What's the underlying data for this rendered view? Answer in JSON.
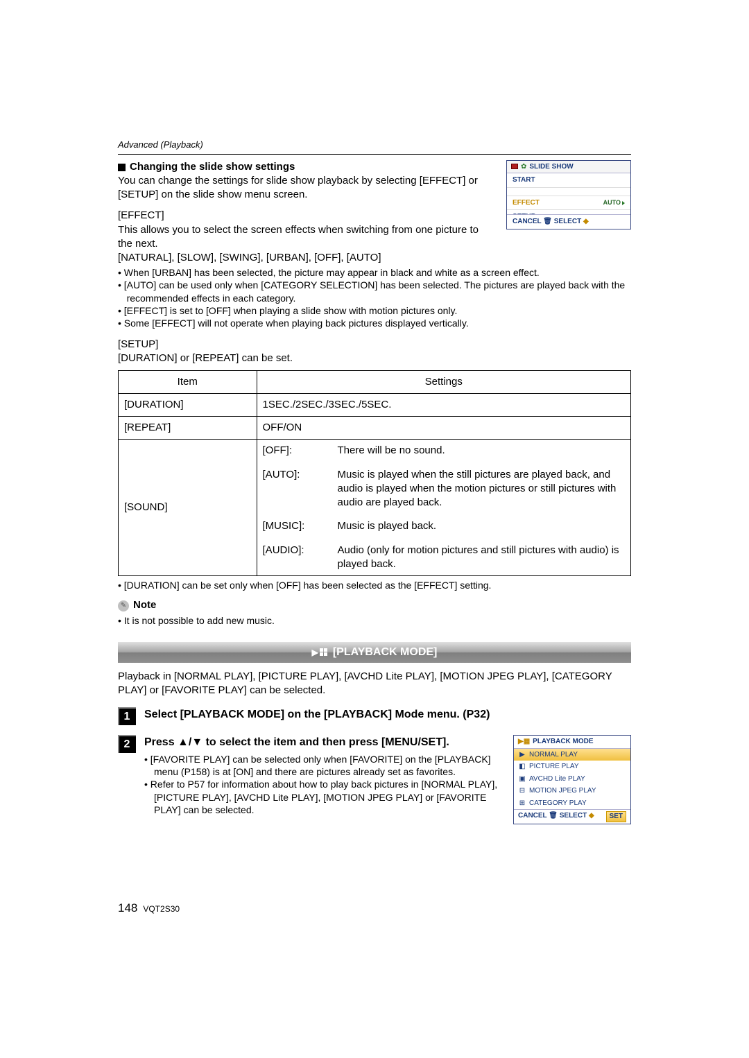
{
  "section": "Advanced (Playback)",
  "slide": {
    "heading": "Changing the slide show settings",
    "intro": "You can change the settings for slide show playback by selecting [EFFECT] or [SETUP] on the slide show menu screen.",
    "effect_title": "[EFFECT]",
    "effect_desc": "This allows you to select the screen effects when switching from one picture to the next.",
    "effect_options": "[NATURAL], [SLOW], [SWING], [URBAN], [OFF], [AUTO]",
    "effect_bullets": [
      "When [URBAN] has been selected, the picture may appear in black and white as a screen effect.",
      "[AUTO] can be used only when [CATEGORY SELECTION] has been selected. The pictures are played back with the recommended effects in each category.",
      "[EFFECT] is set to [OFF] when playing a slide show with motion pictures only.",
      "Some [EFFECT] will not operate when playing back pictures displayed vertically."
    ],
    "setup_title": "[SETUP]",
    "setup_desc": "[DURATION] or [REPEAT] can be set."
  },
  "table": {
    "col_item": "Item",
    "col_settings": "Settings",
    "row_duration_item": "[DURATION]",
    "row_duration_val": "1SEC./2SEC./3SEC./5SEC.",
    "row_repeat_item": "[REPEAT]",
    "row_repeat_val": "OFF/ON",
    "row_sound_item": "[SOUND]",
    "sound": {
      "off_k": "[OFF]:",
      "off_v": "There will be no sound.",
      "auto_k": "[AUTO]:",
      "auto_v": "Music is played when the still pictures are played back, and audio is played when the motion pictures or still pictures with audio are played back.",
      "music_k": "[MUSIC]:",
      "music_v": "Music is played back.",
      "audio_k": "[AUDIO]:",
      "audio_v": "Audio (only for motion pictures and still pictures with audio) is played back."
    },
    "after": "[DURATION] can be set only when [OFF] has been selected as the [EFFECT] setting."
  },
  "note": {
    "label": "Note",
    "bullet": "It is not possible to add new music."
  },
  "banner": "[PLAYBACK MODE]",
  "playback_intro": "Playback in [NORMAL PLAY], [PICTURE PLAY], [AVCHD Lite PLAY], [MOTION JPEG PLAY],  [CATEGORY PLAY] or [FAVORITE PLAY] can be selected.",
  "step1": "Select [PLAYBACK MODE] on the [PLAYBACK] Mode menu. (P32)",
  "step2": {
    "heading": "Press ▲/▼ to select the item and then press [MENU/SET].",
    "bullets": [
      "[FAVORITE PLAY] can be selected only when [FAVORITE] on the [PLAYBACK] menu (P158) is at [ON] and there are pictures already set as favorites.",
      "Refer to P57 for information about how to play back pictures in [NORMAL PLAY], [PICTURE PLAY], [AVCHD Lite PLAY], [MOTION JPEG PLAY] or [FAVORITE PLAY] can be selected."
    ]
  },
  "screenshot1": {
    "title": "SLIDE SHOW",
    "start": "START",
    "effect": "EFFECT",
    "effect_val": "AUTO",
    "setup": "SETUP",
    "footer": "CANCEL 🗑 SELECT"
  },
  "screenshot2": {
    "title": "PLAYBACK MODE",
    "rows": [
      "NORMAL PLAY",
      "PICTURE PLAY",
      "AVCHD Lite PLAY",
      "MOTION JPEG PLAY",
      "CATEGORY PLAY"
    ],
    "footer_left": "CANCEL 🗑 SELECT",
    "footer_right": "SET"
  },
  "footer": {
    "page": "148",
    "code": "VQT2S30"
  }
}
